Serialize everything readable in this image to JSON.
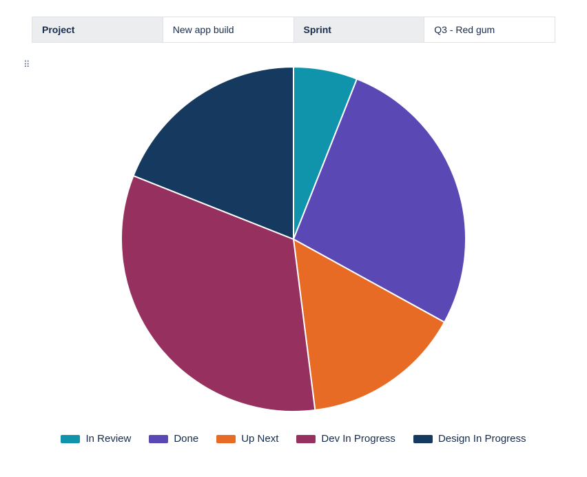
{
  "header": {
    "project_label": "Project",
    "project_value": "New app build",
    "sprint_label": "Sprint",
    "sprint_value": "Q3 - Red gum"
  },
  "chart_data": {
    "type": "pie",
    "title": "",
    "series": [
      {
        "name": "In Review",
        "value": 6,
        "color": "#0f94ab"
      },
      {
        "name": "Done",
        "value": 27,
        "color": "#5a48b4"
      },
      {
        "name": "Up Next",
        "value": 15,
        "color": "#e76b25"
      },
      {
        "name": "Dev In Progress",
        "value": 33,
        "color": "#96305f"
      },
      {
        "name": "Design In Progress",
        "value": 19,
        "color": "#163a5f"
      }
    ]
  }
}
